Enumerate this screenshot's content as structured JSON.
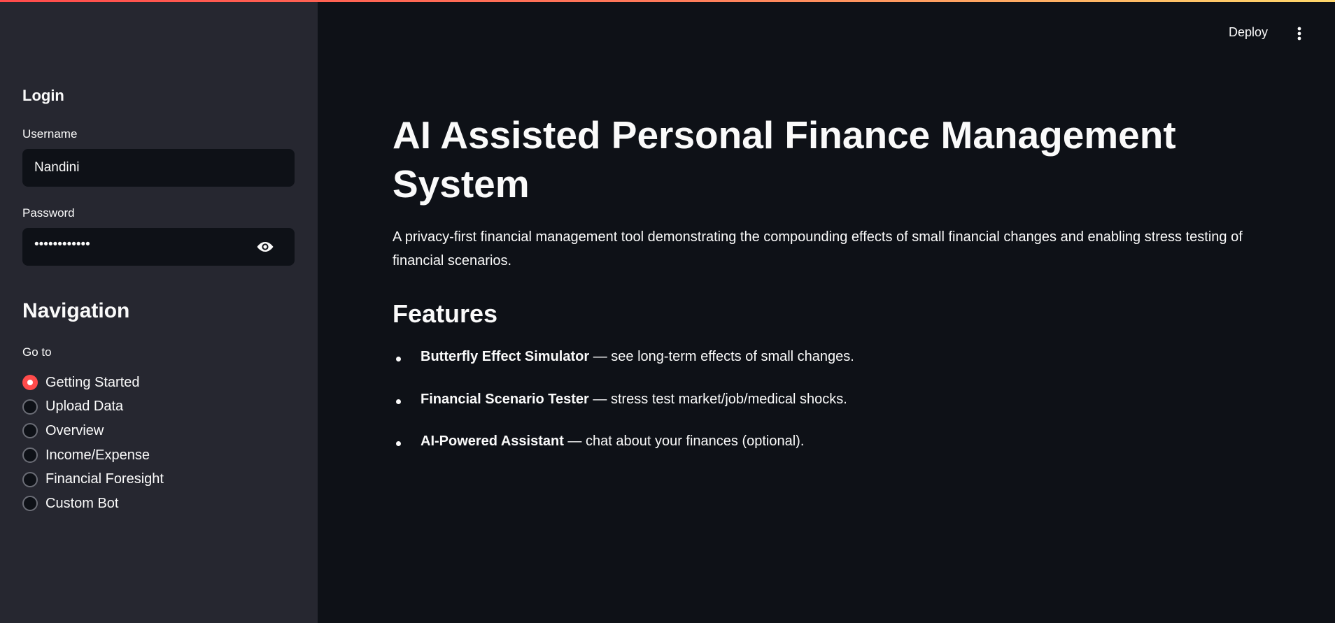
{
  "sidebar": {
    "login_heading": "Login",
    "username_label": "Username",
    "username_value": "Nandini",
    "password_label": "Password",
    "password_masked": "••••••••••••",
    "password_toggle_icon": "eye-icon",
    "navigation_heading": "Navigation",
    "goto_label": "Go to",
    "nav_items": [
      {
        "label": "Getting Started",
        "selected": true
      },
      {
        "label": "Upload Data",
        "selected": false
      },
      {
        "label": "Overview",
        "selected": false
      },
      {
        "label": "Income/Expense",
        "selected": false
      },
      {
        "label": "Financial Foresight",
        "selected": false
      },
      {
        "label": "Custom Bot",
        "selected": false
      }
    ]
  },
  "header": {
    "deploy_label": "Deploy",
    "menu_icon": "vertical-dots-icon"
  },
  "main": {
    "title": "AI Assisted Personal Finance Management System",
    "intro": "A privacy-first financial management tool demonstrating the compounding effects of small financial changes and enabling stress testing of financial scenarios.",
    "features_heading": "Features",
    "features": [
      {
        "name": "Butterfly Effect Simulator",
        "desc": " — see long-term effects of small changes."
      },
      {
        "name": "Financial Scenario Tester",
        "desc": " — stress test market/job/medical shocks."
      },
      {
        "name": "AI-Powered Assistant",
        "desc": " — chat about your finances (optional)."
      }
    ]
  },
  "colors": {
    "accent": "#ff4b4b",
    "sidebar_bg": "#262730",
    "main_bg": "#0e1117"
  }
}
